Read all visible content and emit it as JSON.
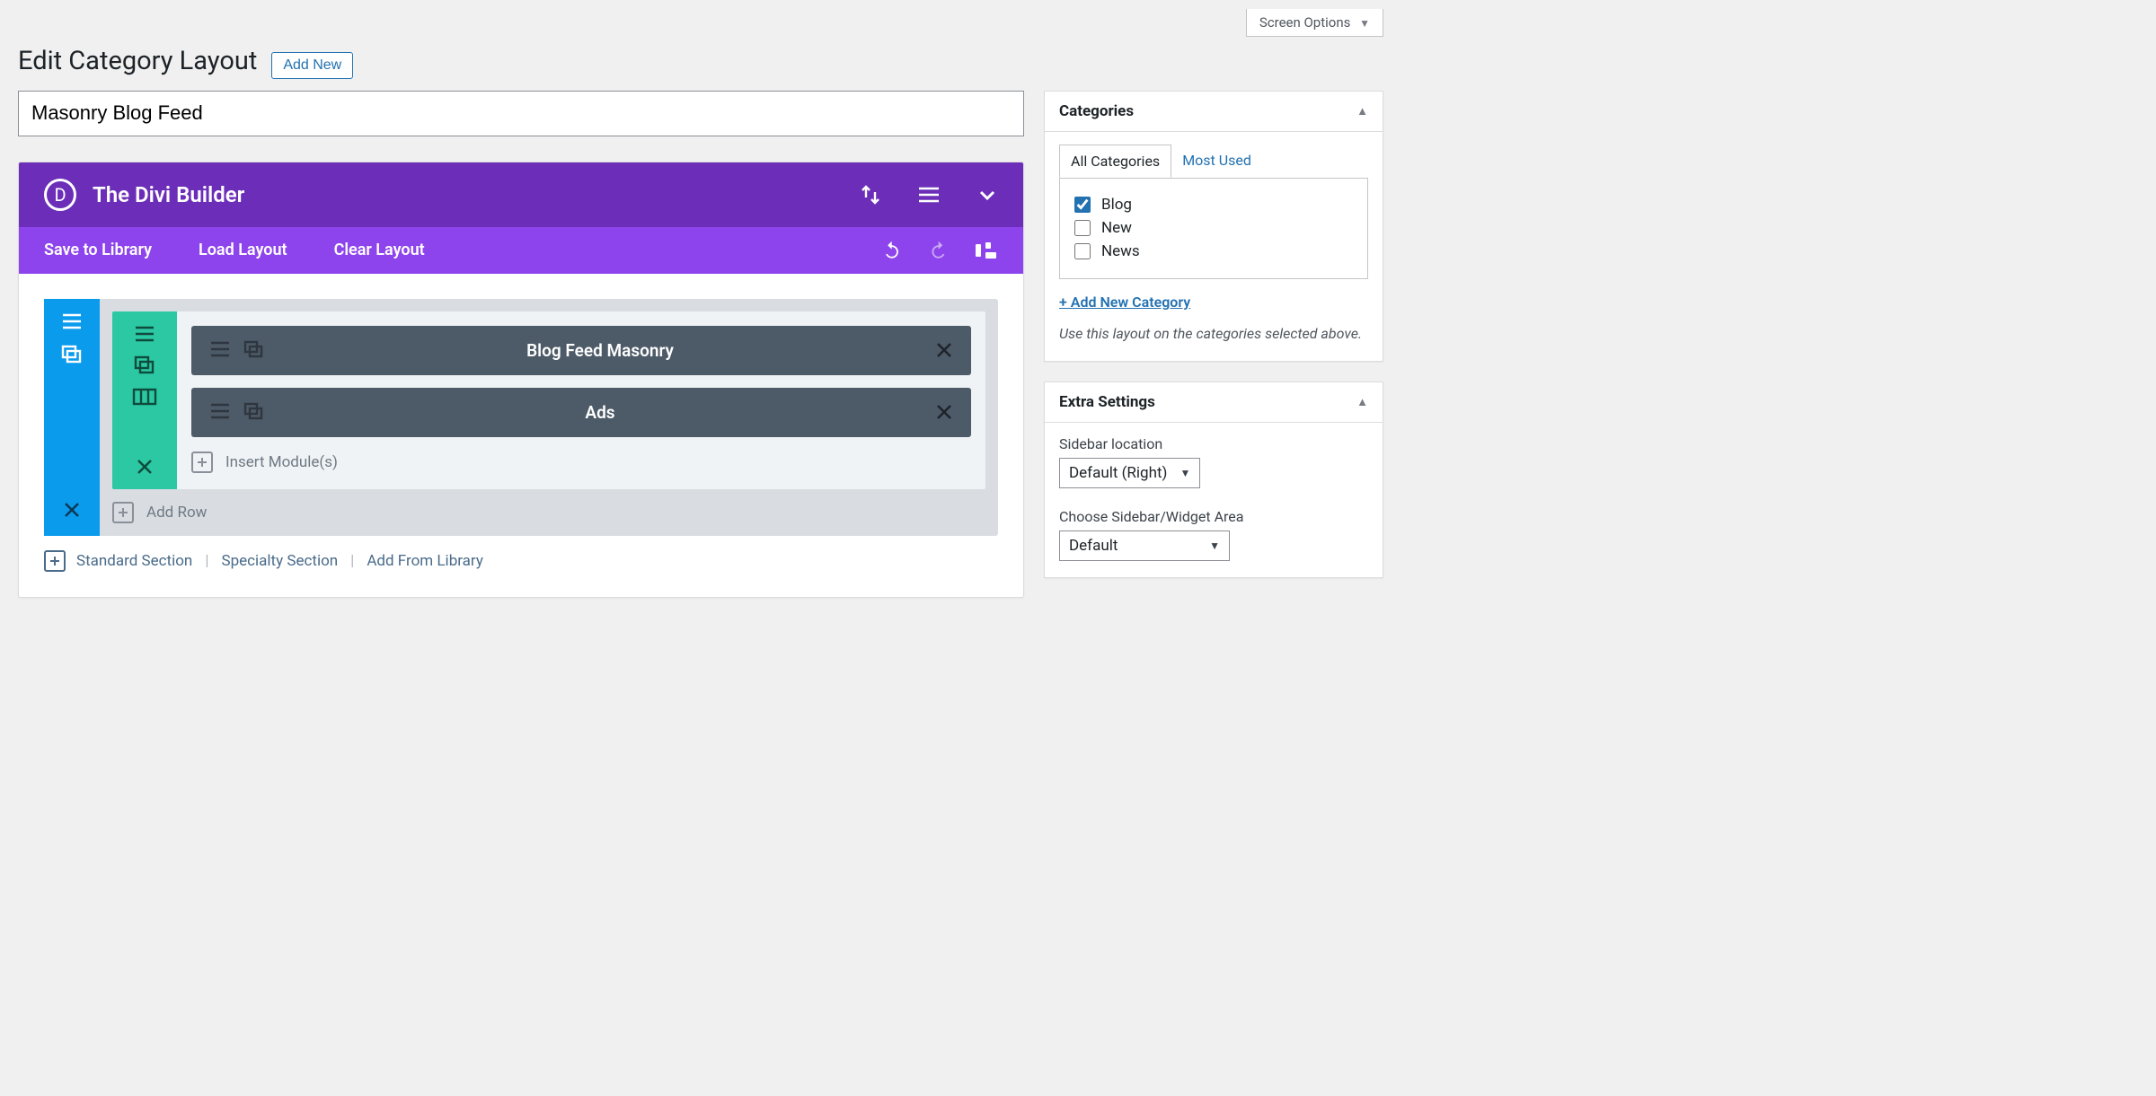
{
  "screen_options": "Screen Options",
  "page_title": "Edit Category Layout",
  "add_new": "Add New",
  "title_value": "Masonry Blog Feed",
  "divi": {
    "title": "The Divi Builder",
    "toolbar": {
      "save": "Save to Library",
      "load": "Load Layout",
      "clear": "Clear Layout"
    }
  },
  "modules": [
    {
      "label": "Blog Feed Masonry"
    },
    {
      "label": "Ads"
    }
  ],
  "insert_modules": "Insert Module(s)",
  "add_row": "Add Row",
  "footer": {
    "standard": "Standard Section",
    "specialty": "Specialty Section",
    "library": "Add From Library"
  },
  "sidebar": {
    "categories_header": "Categories",
    "tabs": {
      "all": "All Categories",
      "most": "Most Used"
    },
    "items": [
      {
        "label": "Blog",
        "checked": true
      },
      {
        "label": "New",
        "checked": false
      },
      {
        "label": "News",
        "checked": false
      }
    ],
    "add_new_category": "+ Add New Category",
    "hint": "Use this layout on the categories selected above.",
    "extra_header": "Extra Settings",
    "sidebar_location_label": "Sidebar location",
    "sidebar_location_value": "Default (Right)",
    "widget_area_label": "Choose Sidebar/Widget Area",
    "widget_area_value": "Default"
  }
}
